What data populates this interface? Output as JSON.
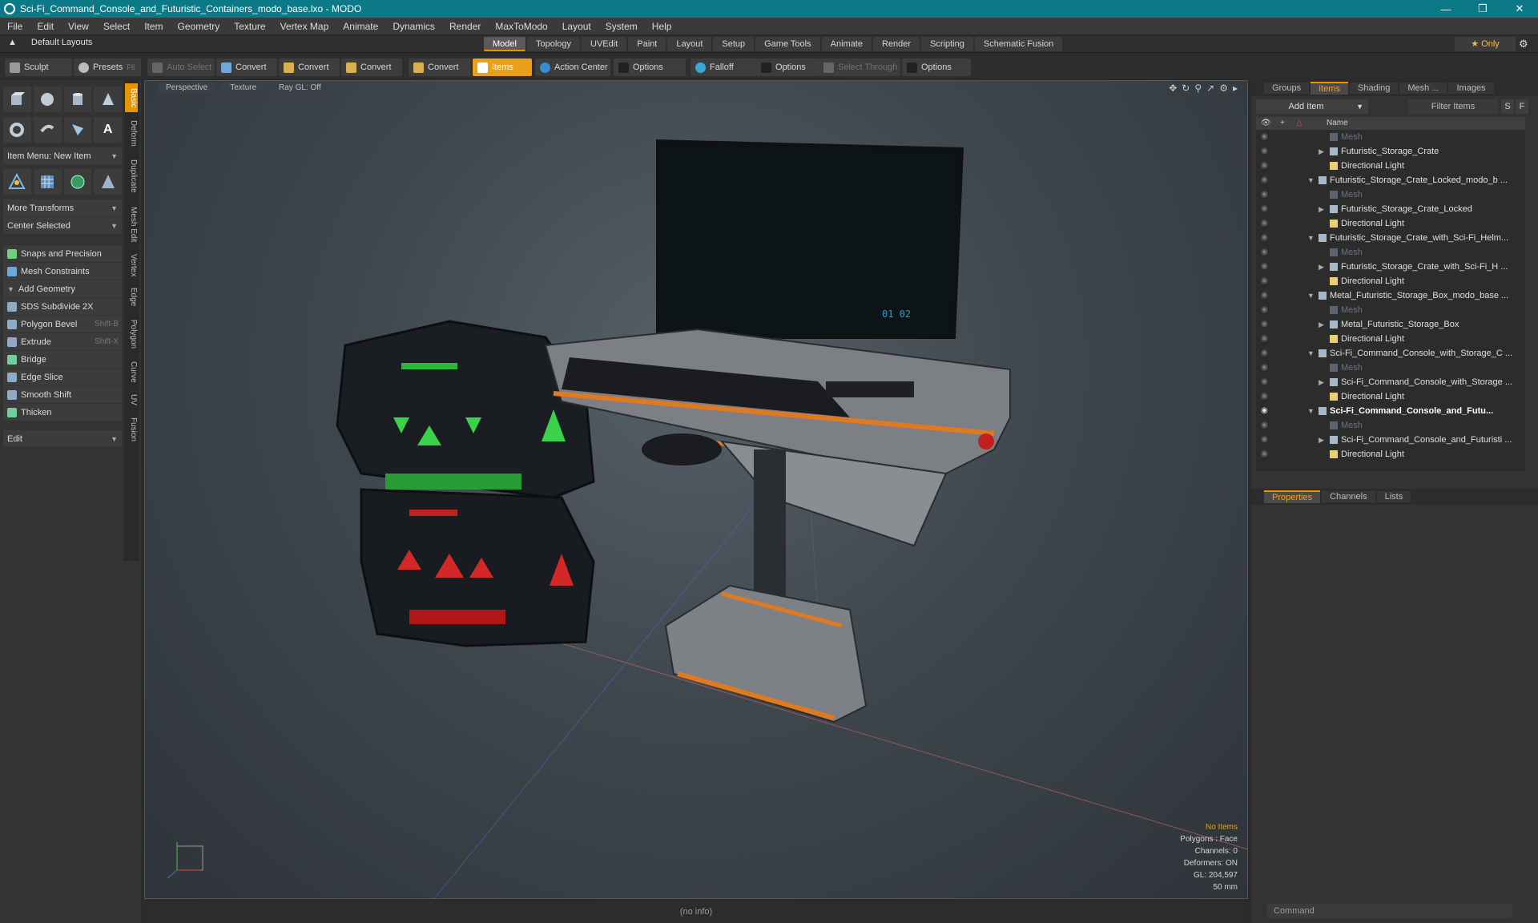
{
  "title": "Sci-Fi_Command_Console_and_Futuristic_Containers_modo_base.lxo - MODO",
  "menu": [
    "File",
    "Edit",
    "View",
    "Select",
    "Item",
    "Geometry",
    "Texture",
    "Vertex Map",
    "Animate",
    "Dynamics",
    "Render",
    "MaxToModo",
    "Layout",
    "System",
    "Help"
  ],
  "layout": {
    "default_layouts": "Default Layouts",
    "tabs": [
      "Model",
      "Topology",
      "UVEdit",
      "Paint",
      "Layout",
      "Setup",
      "Game Tools",
      "Animate",
      "Render",
      "Scripting",
      "Schematic Fusion"
    ],
    "only": "Only"
  },
  "toolbar": {
    "sculpt": "Sculpt",
    "presets": "Presets",
    "presets_key": "F6",
    "auto_select": "Auto Select",
    "convert1": "Convert",
    "convert2": "Convert",
    "convert3": "Convert",
    "convert4": "Convert",
    "items": "Items",
    "action_center": "Action Center",
    "options1": "Options",
    "falloff": "Falloff",
    "options2": "Options",
    "select_through": "Select Through",
    "options3": "Options"
  },
  "left": {
    "item_menu": "Item Menu: New Item",
    "more_transforms": "More Transforms",
    "center_selected": "Center Selected",
    "snaps": "Snaps and Precision",
    "mesh_constraints": "Mesh Constraints",
    "add_geometry": "Add Geometry",
    "sds": "SDS Subdivide 2X",
    "polygon_bevel": "Polygon Bevel",
    "polygon_bevel_key": "Shift-B",
    "extrude": "Extrude",
    "extrude_key": "Shift-X",
    "bridge": "Bridge",
    "edge_slice": "Edge Slice",
    "smooth_shift": "Smooth Shift",
    "thicken": "Thicken",
    "edit": "Edit",
    "vtabs": [
      "Basic",
      "Deform",
      "Duplicate",
      "Mesh Edit",
      "Vertex",
      "Edge",
      "Polygon",
      "Curve",
      "UV",
      "Fusion"
    ]
  },
  "viewport": {
    "perspective": "Perspective",
    "texture": "Texture",
    "raygl": "Ray GL: Off",
    "info": {
      "no_items": "No Items",
      "polygons": "Polygons : Face",
      "channels": "Channels: 0",
      "deformers": "Deformers: ON",
      "gl": "GL: 204,597",
      "mm": "50 mm"
    }
  },
  "status": "(no info)",
  "right": {
    "tabs": [
      "Groups",
      "Items",
      "Shading",
      "Mesh ...",
      "Images"
    ],
    "add_item": "Add Item",
    "filter": "Filter Items",
    "s": "S",
    "f": "F",
    "name_header": "Name",
    "tree": [
      {
        "label": "Mesh",
        "depth": 2,
        "dim": true
      },
      {
        "label": "Futuristic_Storage_Crate",
        "depth": 2,
        "arrow": "▶"
      },
      {
        "label": "Directional Light",
        "depth": 2
      },
      {
        "label": "Futuristic_Storage_Crate_Locked_modo_b ...",
        "depth": 1,
        "arrow": "▼"
      },
      {
        "label": "Mesh",
        "depth": 2,
        "dim": true
      },
      {
        "label": "Futuristic_Storage_Crate_Locked",
        "depth": 2,
        "arrow": "▶"
      },
      {
        "label": "Directional Light",
        "depth": 2
      },
      {
        "label": "Futuristic_Storage_Crate_with_Sci-Fi_Helm...",
        "depth": 1,
        "arrow": "▼"
      },
      {
        "label": "Mesh",
        "depth": 2,
        "dim": true
      },
      {
        "label": "Futuristic_Storage_Crate_with_Sci-Fi_H ...",
        "depth": 2,
        "arrow": "▶"
      },
      {
        "label": "Directional Light",
        "depth": 2
      },
      {
        "label": "Metal_Futuristic_Storage_Box_modo_base ...",
        "depth": 1,
        "arrow": "▼"
      },
      {
        "label": "Mesh",
        "depth": 2,
        "dim": true
      },
      {
        "label": "Metal_Futuristic_Storage_Box",
        "depth": 2,
        "arrow": "▶"
      },
      {
        "label": "Directional Light",
        "depth": 2
      },
      {
        "label": "Sci-Fi_Command_Console_with_Storage_C ...",
        "depth": 1,
        "arrow": "▼"
      },
      {
        "label": "Mesh",
        "depth": 2,
        "dim": true
      },
      {
        "label": "Sci-Fi_Command_Console_with_Storage ...",
        "depth": 2,
        "arrow": "▶"
      },
      {
        "label": "Directional Light",
        "depth": 2
      },
      {
        "label": "Sci-Fi_Command_Console_and_Futu...",
        "depth": 1,
        "arrow": "▼",
        "bold": true
      },
      {
        "label": "Mesh",
        "depth": 2,
        "dim": true
      },
      {
        "label": "Sci-Fi_Command_Console_and_Futuristi ...",
        "depth": 2,
        "arrow": "▶"
      },
      {
        "label": "Directional Light",
        "depth": 2
      }
    ],
    "prop_tabs": [
      "Properties",
      "Channels",
      "Lists"
    ],
    "command": "Command"
  }
}
